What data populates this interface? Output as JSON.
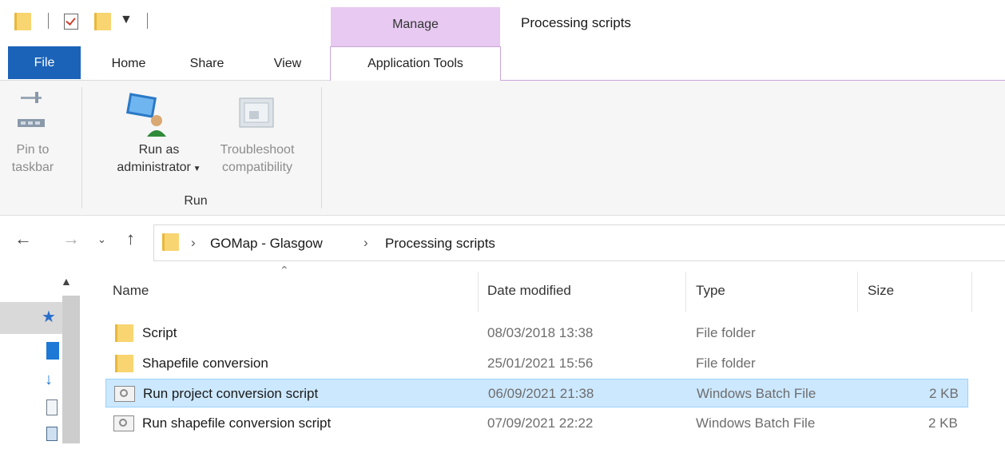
{
  "window": {
    "title": "Processing scripts",
    "contextual_group": "Manage"
  },
  "ribbon": {
    "tabs": {
      "file": "File",
      "home": "Home",
      "share": "Share",
      "view": "View",
      "application_tools": "Application Tools"
    },
    "pin": {
      "line1": "Pin to",
      "line2": "taskbar"
    },
    "run_as": {
      "line1": "Run as",
      "line2": "administrator"
    },
    "troubleshoot": {
      "line1": "Troubleshoot",
      "line2": "compatibility"
    },
    "group_run": "Run"
  },
  "address": {
    "crumbs": [
      "GOMap - Glasgow",
      "Processing scripts"
    ]
  },
  "columns": {
    "name": "Name",
    "date": "Date modified",
    "type": "Type",
    "size": "Size"
  },
  "files": [
    {
      "name": "Script",
      "date": "08/03/2018 13:38",
      "type": "File folder",
      "size": "",
      "icon": "folder-icon",
      "selected": false
    },
    {
      "name": "Shapefile conversion",
      "date": "25/01/2021 15:56",
      "type": "File folder",
      "size": "",
      "icon": "folder-icon",
      "selected": false
    },
    {
      "name": "Run project conversion script",
      "date": "06/09/2021 21:38",
      "type": "Windows Batch File",
      "size": "2 KB",
      "icon": "batch-file-icon",
      "selected": true
    },
    {
      "name": "Run shapefile conversion script",
      "date": "07/09/2021 22:22",
      "type": "Windows Batch File",
      "size": "2 KB",
      "icon": "batch-file-icon",
      "selected": false
    }
  ],
  "colors": {
    "file_tab": "#1b63b8",
    "contextual_tab": "#e7c9f1",
    "selection": "#cce8ff",
    "folder": "#f8d571"
  }
}
